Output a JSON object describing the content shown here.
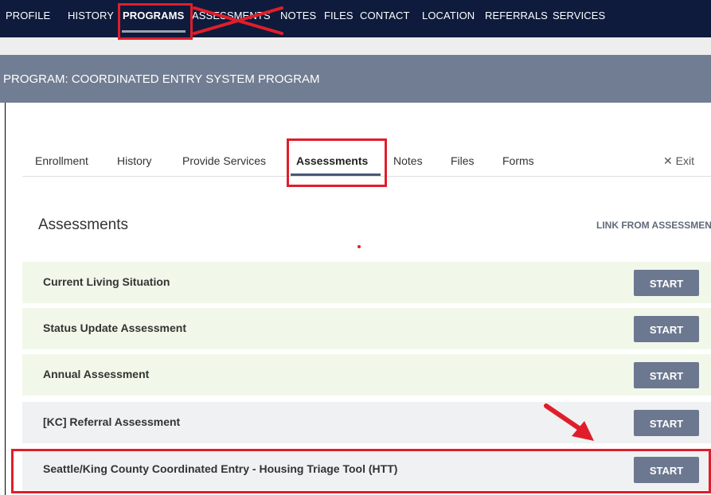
{
  "top_nav": {
    "items": [
      "PROFILE",
      "HISTORY",
      "PROGRAMS",
      "ASSESSMENTS",
      "NOTES",
      "FILES",
      "CONTACT",
      "LOCATION",
      "REFERRALS",
      "SERVICES"
    ],
    "active": "PROGRAMS"
  },
  "program_header": {
    "title": "PROGRAM: COORDINATED ENTRY SYSTEM PROGRAM"
  },
  "tabs": {
    "items": [
      "Enrollment",
      "History",
      "Provide Services",
      "Assessments",
      "Notes",
      "Files",
      "Forms"
    ],
    "active": "Assessments",
    "exit_icon": "close-icon",
    "exit_label": "Exit"
  },
  "assessments": {
    "title": "Assessments",
    "link_label": "LINK FROM ASSESSMENT",
    "start_label": "START",
    "rows": [
      {
        "name": "Current Living Situation",
        "bg": "#f1f8ea"
      },
      {
        "name": "Status Update Assessment",
        "bg": "#f1f8ea"
      },
      {
        "name": "Annual Assessment",
        "bg": "#f1f8ea"
      },
      {
        "name": "[KC] Referral Assessment",
        "bg": "#f0f1f2"
      },
      {
        "name": "Seattle/King County Coordinated Entry - Housing Triage Tool (HTT)",
        "bg": "#f0f1f2"
      }
    ]
  },
  "colors": {
    "nav_bg": "#0e1b3c",
    "header_bg": "#717d92",
    "button_bg": "#6c7890",
    "annotation_red": "#e01e2b"
  }
}
